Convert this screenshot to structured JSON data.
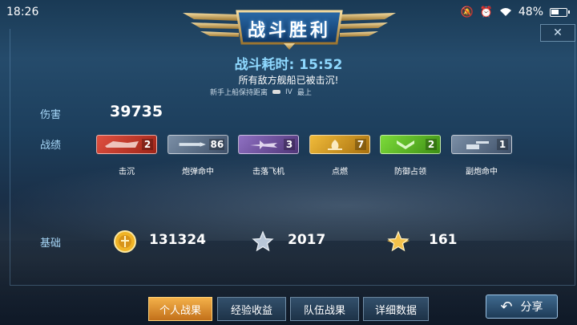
{
  "status_bar": {
    "time": "18:26",
    "battery": "48%",
    "icons": [
      "mute-icon",
      "alarm-icon",
      "wifi-icon",
      "battery-icon"
    ]
  },
  "header": {
    "title": "战斗胜利",
    "close_icon": "close-icon"
  },
  "result": {
    "time_label": "战斗耗时:",
    "time_value": "15:52",
    "message": "所有敌方舰船已被击沉!",
    "tip_text": "新手上船保持距离",
    "tip_grade": "IV",
    "tip_level": "最上"
  },
  "damage": {
    "label": "伤害",
    "value": "39735"
  },
  "achievements": {
    "label": "战绩",
    "items": [
      {
        "name": "击沉",
        "count": "2",
        "icon": "ship-sink-icon",
        "color": "#c43a2e"
      },
      {
        "name": "炮弹命中",
        "count": "86",
        "icon": "shell-icon",
        "color": "#5a6f86"
      },
      {
        "name": "击落飞机",
        "count": "3",
        "icon": "plane-icon",
        "color": "#6c4f9a"
      },
      {
        "name": "点燃",
        "count": "7",
        "icon": "fire-icon",
        "color": "#d39a20"
      },
      {
        "name": "防御占领",
        "count": "2",
        "icon": "chevron-icon",
        "color": "#5bb82a"
      },
      {
        "name": "副炮命中",
        "count": "1",
        "icon": "secondary-gun-icon",
        "color": "#5a6f86"
      }
    ]
  },
  "base": {
    "label": "基础",
    "coins": "131324",
    "experience": "2017",
    "commander_xp": "161"
  },
  "tabs": [
    {
      "label": "个人战果",
      "active": true
    },
    {
      "label": "经验收益",
      "active": false
    },
    {
      "label": "队伍战果",
      "active": false
    },
    {
      "label": "详细数据",
      "active": false
    }
  ],
  "share": {
    "label": "分享"
  }
}
